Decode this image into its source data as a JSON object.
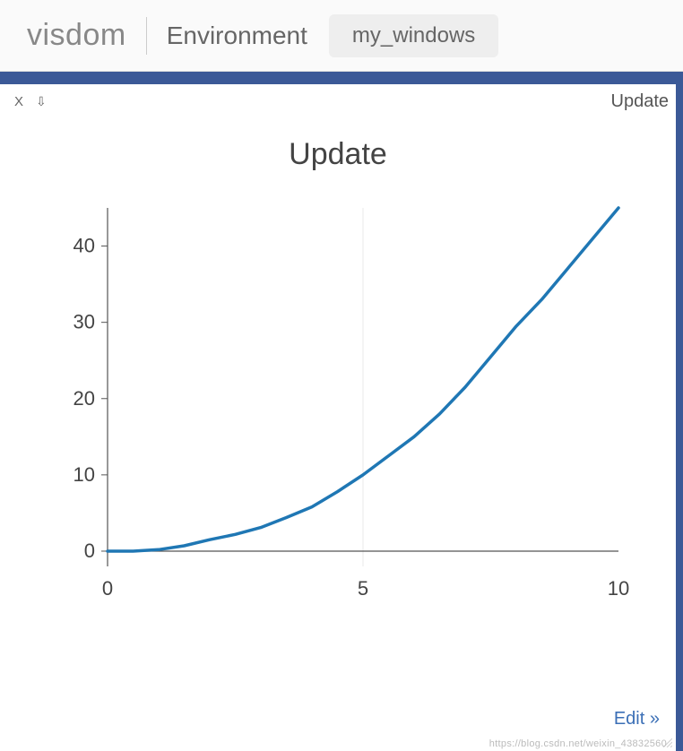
{
  "header": {
    "logo": "visdom",
    "env_label": "Environment",
    "env_name": "my_windows"
  },
  "panel": {
    "close": "X",
    "download": "⇩",
    "title_right": "Update",
    "edit": "Edit »"
  },
  "chart_data": {
    "type": "line",
    "title": "Update",
    "xlabel": "",
    "ylabel": "",
    "xlim": [
      0,
      10
    ],
    "ylim": [
      -2,
      45
    ],
    "x_ticks": [
      0,
      5,
      10
    ],
    "y_ticks": [
      0,
      10,
      20,
      30,
      40
    ],
    "x": [
      0,
      0.5,
      1,
      1.5,
      2,
      2.5,
      3,
      3.5,
      4,
      4.5,
      5,
      5.5,
      6,
      6.5,
      7,
      7.5,
      8,
      8.5,
      9,
      9.5,
      10
    ],
    "values": [
      0,
      0,
      0.2,
      0.7,
      1.5,
      2.2,
      3.1,
      4.4,
      5.8,
      7.8,
      10,
      12.5,
      15,
      18,
      21.5,
      25.5,
      29.5,
      33,
      37,
      41,
      45
    ],
    "line_color": "#1f77b4"
  },
  "watermark": "https://blog.csdn.net/weixin_43832560"
}
